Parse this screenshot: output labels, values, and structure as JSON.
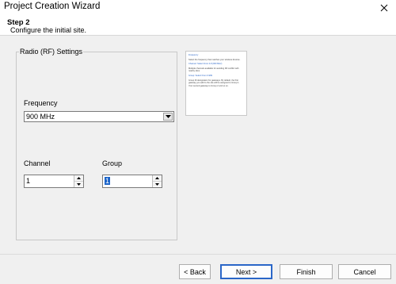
{
  "window": {
    "title": "Project Creation Wizard"
  },
  "header": {
    "step": "Step 2",
    "subtitle": "Configure the initial site."
  },
  "radio_settings": {
    "legend": "Radio (RF) Settings",
    "frequency": {
      "label": "Frequency",
      "value": "900 MHz"
    },
    "channel": {
      "label": "Channel",
      "value": "1"
    },
    "group": {
      "label": "Group",
      "value": "1"
    }
  },
  "help_panel": {
    "paragraphs": [
      {
        "text": "Frequency",
        "heading": true
      },
      {
        "text": "Select the frequency that matches your wireless devices.",
        "heading": false
      },
      {
        "text": "Channel: Select From 0-8 (900 MHz)",
        "heading": true
      },
      {
        "text": "Multiple channels available for avoiding RF conflict with nearby sites.",
        "heading": false
      },
      {
        "text": "Group: Select From 0-999",
        "heading": true
      },
      {
        "text": "Group ID designation for gateways. By default, the first gateway you add to the site will be assigned to Group 1. Your second gateway to Group 2 and so on.",
        "heading": false
      }
    ]
  },
  "buttons": {
    "back": "< Back",
    "next": "Next >",
    "finish": "Finish",
    "cancel": "Cancel"
  }
}
